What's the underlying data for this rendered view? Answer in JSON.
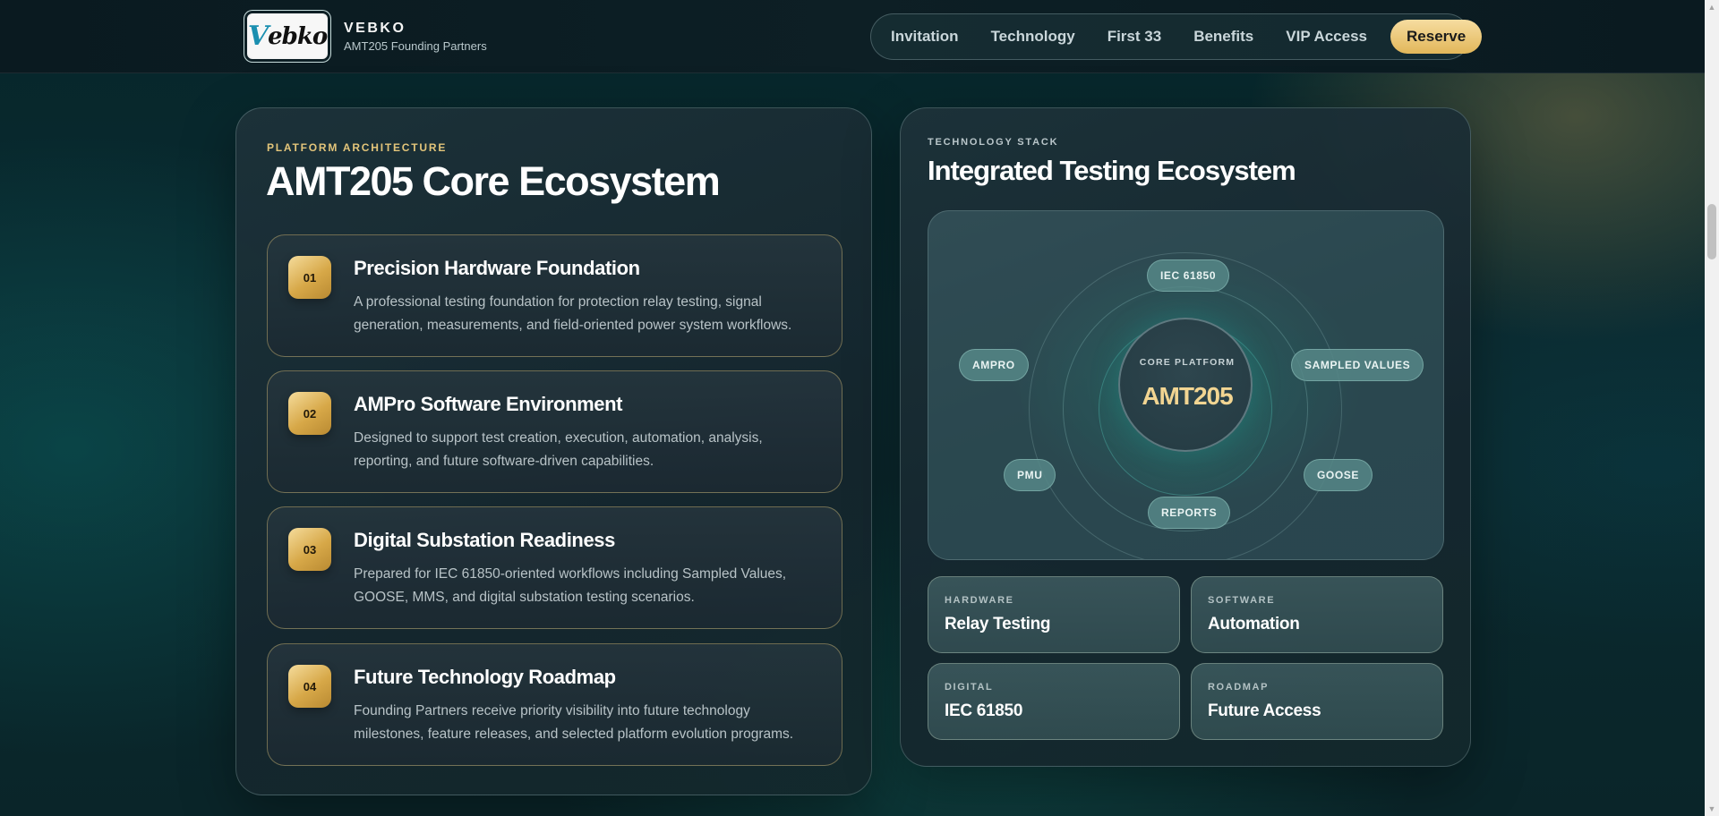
{
  "header": {
    "logo_text": "Vebko",
    "brand_name": "VEBKO",
    "brand_subtitle": "AMT205 Founding Partners",
    "nav": [
      "Invitation",
      "Technology",
      "First 33",
      "Benefits",
      "VIP Access"
    ],
    "cta_label": "Reserve"
  },
  "architecture": {
    "eyebrow": "PLATFORM ARCHITECTURE",
    "title": "AMT205 Core Ecosystem",
    "features": [
      {
        "num": "01",
        "title": "Precision Hardware Foundation",
        "desc": "A professional testing foundation for protection relay testing, signal generation, measurements, and field-oriented power system workflows."
      },
      {
        "num": "02",
        "title": "AMPro Software Environment",
        "desc": "Designed to support test creation, execution, automation, analysis, reporting, and future software-driven capabilities."
      },
      {
        "num": "03",
        "title": "Digital Substation Readiness",
        "desc": "Prepared for IEC 61850-oriented workflows including Sampled Values, GOOSE, MMS, and digital substation testing scenarios."
      },
      {
        "num": "04",
        "title": "Future Technology Roadmap",
        "desc": "Founding Partners receive priority visibility into future technology milestones, feature releases, and selected platform evolution programs."
      }
    ]
  },
  "stack": {
    "eyebrow": "TECHNOLOGY STACK",
    "title": "Integrated Testing Ecosystem",
    "core_label": "CORE PLATFORM",
    "core_name": "AMT205",
    "nodes": {
      "top": "IEC 61850",
      "left": "AMPRO",
      "right": "SAMPLED VALUES",
      "bottom_left": "PMU",
      "bottom_right": "GOOSE",
      "bottom": "REPORTS"
    },
    "cards": [
      {
        "label": "HARDWARE",
        "value": "Relay Testing"
      },
      {
        "label": "SOFTWARE",
        "value": "Automation"
      },
      {
        "label": "DIGITAL",
        "value": "IEC 61850"
      },
      {
        "label": "ROADMAP",
        "value": "Future Access"
      }
    ]
  },
  "colors": {
    "gold_accent": "#e3c57a",
    "core_name": "#f2d592",
    "chip_bg": "#568787"
  }
}
